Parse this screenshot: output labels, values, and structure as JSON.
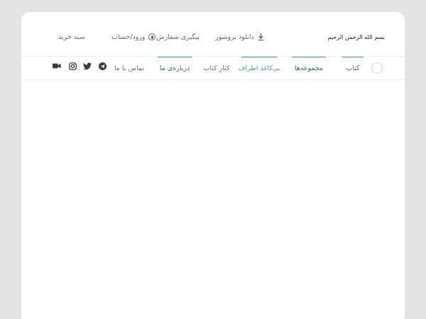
{
  "header": {
    "site_title": "بسم الله الرحمن الرحیم",
    "links": {
      "cart": "سبد خرید",
      "login": "ورود/حساب",
      "track": "پیگیری سفارش",
      "brochure": "دانلود بروشور"
    }
  },
  "nav": {
    "items": [
      {
        "label": "کتاب"
      },
      {
        "label": "مجموعه‌ها"
      },
      {
        "label": "بی‌کاغذ اطراف"
      },
      {
        "label": "کنارِ کتاب"
      },
      {
        "label": "درباره‌ی ما"
      },
      {
        "label": "تماس با ما"
      }
    ]
  },
  "social": [
    "telegram-icon",
    "twitter-icon",
    "instagram-icon",
    "video-icon"
  ],
  "colors": {
    "background": "#e4e4e4",
    "card": "#ffffff",
    "accent": "#3f9a92",
    "link_dark": "#2f6d7b",
    "link_teal": "#3aa9a2"
  }
}
